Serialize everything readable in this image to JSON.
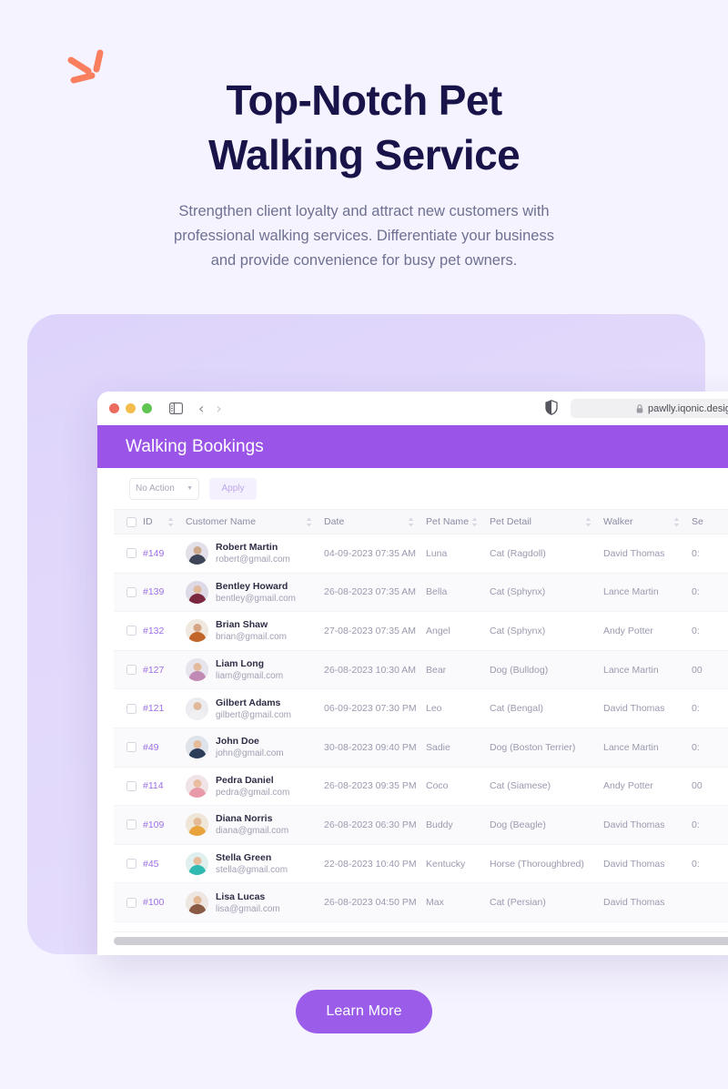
{
  "hero": {
    "title_line1": "Top-Notch Pet",
    "title_line2": "Walking Service",
    "sub_line1": "Strengthen client loyalty and attract new customers with",
    "sub_line2": "professional walking services. Differentiate your business",
    "sub_line3": "and provide convenience for busy pet owners.",
    "accent_color": "#fa7f5f",
    "title_color": "#18144a",
    "background_color": "#f5f3ff"
  },
  "browser": {
    "url": "pawlly.iqonic.design",
    "lock_icon": "lock-icon",
    "shield_icon": "shield-icon",
    "sidebar_icon": "sidebar-toggle-icon",
    "back_icon": "chevron-left-icon",
    "forward_icon": "chevron-right-icon",
    "traffic_red": "#ec6a5e",
    "traffic_yellow": "#f2bd4c",
    "traffic_green": "#61c554"
  },
  "app": {
    "header_title": "Walking Bookings",
    "header_color": "#9a55e8",
    "toolbar": {
      "action_select_value": "No Action",
      "apply_label": "Apply"
    }
  },
  "table": {
    "columns": [
      {
        "label": "",
        "key": "check"
      },
      {
        "label": "ID",
        "key": "id"
      },
      {
        "label": "Customer Name",
        "key": "customer"
      },
      {
        "label": "Date",
        "key": "date"
      },
      {
        "label": "Pet Name",
        "key": "pet_name"
      },
      {
        "label": "Pet Detail",
        "key": "pet_detail"
      },
      {
        "label": "Walker",
        "key": "walker"
      },
      {
        "label": "Se",
        "key": "service"
      }
    ],
    "rows": [
      {
        "id": "#149",
        "name": "Robert Martin",
        "email": "robert@gmail.com",
        "date": "04-09-2023 07:35 AM",
        "pet_name": "Luna",
        "pet_detail": "Cat (Ragdoll)",
        "walker": "David Thomas",
        "service": "0:",
        "skin": "#cda98c",
        "shirt": "#3d4556",
        "bg": "#e4e0ea"
      },
      {
        "id": "#139",
        "name": "Bentley Howard",
        "email": "bentley@gmail.com",
        "date": "26-08-2023 07:35 AM",
        "pet_name": "Bella",
        "pet_detail": "Cat (Sphynx)",
        "walker": "Lance Martin",
        "service": "0:",
        "skin": "#e0b99b",
        "shirt": "#7b2740",
        "bg": "#ded9e6"
      },
      {
        "id": "#132",
        "name": "Brian Shaw",
        "email": "brian@gmail.com",
        "date": "27-08-2023 07:35 AM",
        "pet_name": "Angel",
        "pet_detail": "Cat (Sphynx)",
        "walker": "Andy Potter",
        "service": "0:",
        "skin": "#d6a583",
        "shirt": "#c2652a",
        "bg": "#efe9e0"
      },
      {
        "id": "#127",
        "name": "Liam Long",
        "email": "liam@gmail.com",
        "date": "26-08-2023 10:30 AM",
        "pet_name": "Bear",
        "pet_detail": "Dog (Bulldog)",
        "walker": "Lance Martin",
        "service": "00",
        "skin": "#e3bb9c",
        "shirt": "#c08ab4",
        "bg": "#e8e4ee"
      },
      {
        "id": "#121",
        "name": "Gilbert Adams",
        "email": "gilbert@gmail.com",
        "date": "06-09-2023 07:30 PM",
        "pet_name": "Leo",
        "pet_detail": "Cat (Bengal)",
        "walker": "David Thomas",
        "service": "0:",
        "skin": "#e0b89a",
        "shirt": "#f0f0f2",
        "bg": "#ecebef"
      },
      {
        "id": "#49",
        "name": "John Doe",
        "email": "john@gmail.com",
        "date": "30-08-2023 09:40 PM",
        "pet_name": "Sadie",
        "pet_detail": "Dog (Boston Terrier)",
        "walker": "Lance Martin",
        "service": "0:",
        "skin": "#e5bb99",
        "shirt": "#2c3d59",
        "bg": "#dfe3ea"
      },
      {
        "id": "#114",
        "name": "Pedra Daniel",
        "email": "pedra@gmail.com",
        "date": "26-08-2023 09:35 PM",
        "pet_name": "Coco",
        "pet_detail": "Cat (Siamese)",
        "walker": "Andy Potter",
        "service": "00",
        "skin": "#e8bda0",
        "shirt": "#e99aa8",
        "bg": "#f0e4e6"
      },
      {
        "id": "#109",
        "name": "Diana Norris",
        "email": "diana@gmail.com",
        "date": "26-08-2023 06:30 PM",
        "pet_name": "Buddy",
        "pet_detail": "Dog (Beagle)",
        "walker": "David Thomas",
        "service": "0:",
        "skin": "#e4b995",
        "shirt": "#e8a33c",
        "bg": "#efe6d8"
      },
      {
        "id": "#45",
        "name": "Stella Green",
        "email": "stella@gmail.com",
        "date": "22-08-2023 10:40 PM",
        "pet_name": "Kentucky",
        "pet_detail": "Horse (Thoroughbred)",
        "walker": "David Thomas",
        "service": "0:",
        "skin": "#e6bd9c",
        "shirt": "#2fb9b0",
        "bg": "#dff0ef"
      },
      {
        "id": "#100",
        "name": "Lisa Lucas",
        "email": "lisa@gmail.com",
        "date": "26-08-2023 04:50 PM",
        "pet_name": "Max",
        "pet_detail": "Cat (Persian)",
        "walker": "David Thomas",
        "service": "",
        "skin": "#e3b894",
        "shirt": "#8a5a44",
        "bg": "#eee6e0"
      }
    ]
  },
  "cta": {
    "learn_more_label": "Learn More",
    "button_color": "#9a5ce9"
  }
}
